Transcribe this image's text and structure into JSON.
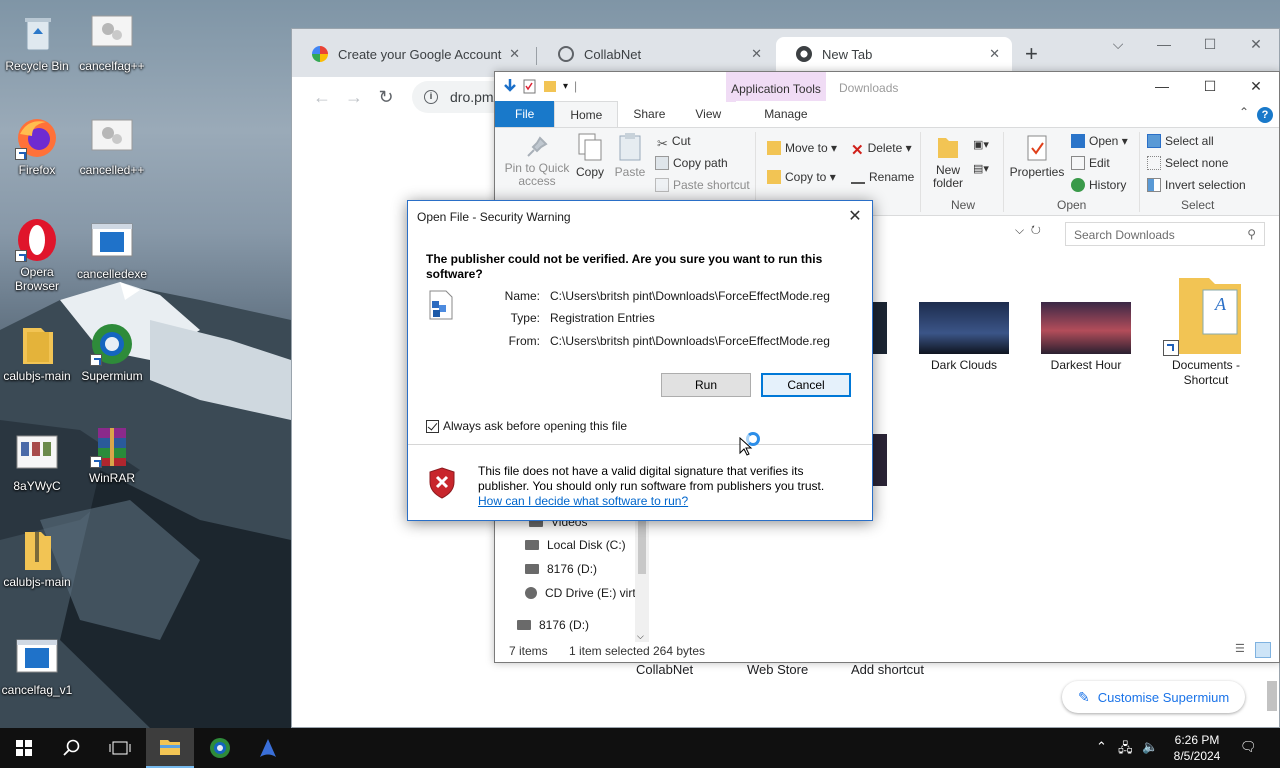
{
  "desktop": {
    "icons": [
      {
        "label": "Recycle Bin"
      },
      {
        "label": "cancelfag++"
      },
      {
        "label": "Firefox"
      },
      {
        "label": "cancelled++"
      },
      {
        "label": "Opera Browser"
      },
      {
        "label": "cancelledexe"
      },
      {
        "label": "calubjs-main"
      },
      {
        "label": "Supermium"
      },
      {
        "label": "8aYWyC"
      },
      {
        "label": "WinRAR"
      },
      {
        "label": "calubjs-main"
      },
      {
        "label": "cancelfag_v1"
      }
    ]
  },
  "browser": {
    "tabs": [
      {
        "title": "Create your Google Account",
        "close": "✕"
      },
      {
        "title": "CollabNet",
        "close": "✕"
      },
      {
        "title": "New Tab",
        "close": "✕"
      }
    ],
    "new_tab": "+",
    "url": "dro.pm/V",
    "shortcuts": [
      "CollabNet",
      "Web Store",
      "Add shortcut"
    ],
    "customise": "Customise Supermium"
  },
  "explorer": {
    "title": "Downloads",
    "context_tab": "Application Tools",
    "ribbon_tabs": [
      "File",
      "Home",
      "Share",
      "View",
      "Manage"
    ],
    "clipboard": {
      "pin": "Pin to Quick access",
      "copy": "Copy",
      "paste": "Paste",
      "cut": "Cut",
      "copy_path": "Copy path",
      "paste_shortcut": "Paste shortcut"
    },
    "organize": {
      "move_to": "Move to",
      "copy_to": "Copy to",
      "delete": "Delete",
      "rename": "Rename"
    },
    "new": {
      "new_folder": "New folder",
      "group": "New"
    },
    "open": {
      "properties": "Properties",
      "open": "Open",
      "edit": "Edit",
      "history": "History",
      "group": "Open"
    },
    "select": {
      "select_all": "Select all",
      "select_none": "Select none",
      "invert": "Invert selection",
      "group": "Select"
    },
    "search_placeholder": "Search Downloads",
    "files": [
      {
        "name": "Dark Clouds"
      },
      {
        "name": "Darkest Hour"
      },
      {
        "name": "Documents - Shortcut"
      }
    ],
    "nav": [
      "Videos",
      "Local Disk (C:)",
      "8176 (D:)",
      "CD Drive (E:) virt",
      "8176 (D:)"
    ],
    "status": {
      "items": "7 items",
      "selected": "1 item selected",
      "size": "264 bytes"
    }
  },
  "dialog": {
    "title": "Open File - Security Warning",
    "question": "The publisher could not be verified.  Are you sure you want to run this software?",
    "fields": [
      {
        "key": "Name:",
        "value": "C:\\Users\\britsh pint\\Downloads\\ForceEffectMode.reg"
      },
      {
        "key": "Type:",
        "value": "Registration Entries"
      },
      {
        "key": "From:",
        "value": "C:\\Users\\britsh pint\\Downloads\\ForceEffectMode.reg"
      }
    ],
    "run": "Run",
    "cancel": "Cancel",
    "checkbox": "Always ask before opening this file",
    "checked": true,
    "warning": "This file does not have a valid digital signature that verifies its publisher.  You should only run software from publishers you trust.",
    "link": "How can I decide what software to run?"
  },
  "taskbar": {
    "time": "6:26 PM",
    "date": "8/5/2024"
  }
}
